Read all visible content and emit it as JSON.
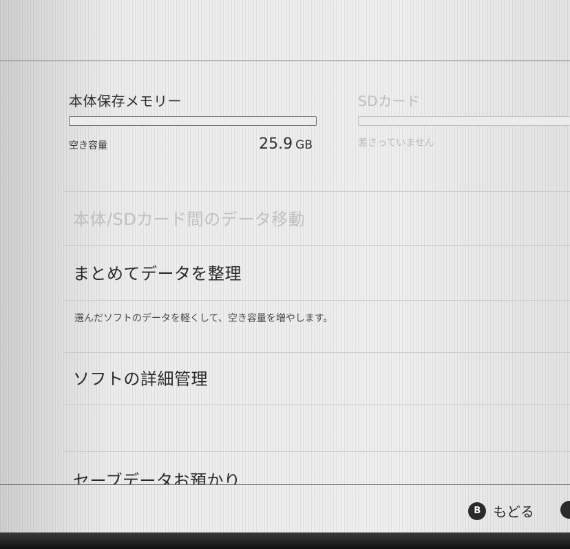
{
  "storage": {
    "internal": {
      "title": "本体保存メモリー",
      "free_label": "空き容量",
      "free_value": "25.9",
      "free_unit": "GB"
    },
    "sd": {
      "title": "SDカード",
      "status": "差さっていません"
    }
  },
  "menu": {
    "move_data": {
      "label": "本体/SDカード間のデータ移動"
    },
    "organize": {
      "label": "まとめてデータを整理",
      "description": "選んだソフトのデータを軽くして、空き容量を増やします。"
    },
    "software_manage": {
      "label": "ソフトの詳細管理"
    },
    "save_cloud": {
      "label": "セーブデータお預かり"
    }
  },
  "footer": {
    "back_button_glyph": "B",
    "back_label": "もどる"
  }
}
